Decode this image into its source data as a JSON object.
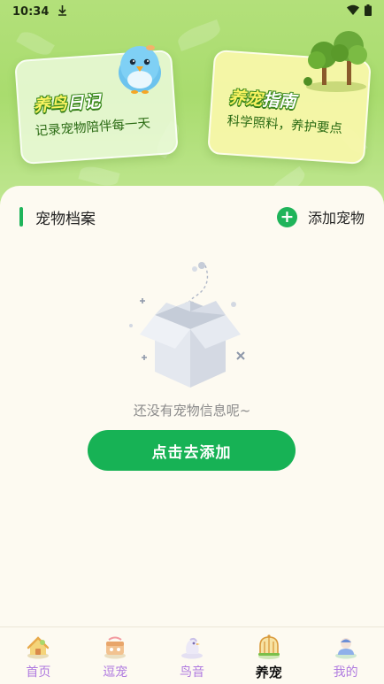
{
  "status_bar": {
    "time": "10:34"
  },
  "cards": {
    "diary": {
      "title_a": "养鸟",
      "title_b": "日记",
      "subtitle": "记录宠物陪伴每一天"
    },
    "guide": {
      "title_a": "养宠",
      "title_b": "指南",
      "subtitle": "科学照料，养护要点"
    }
  },
  "pet_section": {
    "title": "宠物档案",
    "add_label": "添加宠物",
    "empty_text": "还没有宠物信息呢~",
    "cta_label": "点击去添加"
  },
  "tabs": [
    {
      "label": "首页",
      "icon": "home-icon"
    },
    {
      "label": "逗宠",
      "icon": "tease-pet-icon"
    },
    {
      "label": "鸟音",
      "icon": "bird-sound-icon"
    },
    {
      "label": "养宠",
      "icon": "birdcage-icon",
      "active": true
    },
    {
      "label": "我的",
      "icon": "profile-icon"
    }
  ],
  "colors": {
    "accent": "#17b255",
    "tab_inactive": "#b07be0",
    "hero": "#a9dc6e"
  }
}
